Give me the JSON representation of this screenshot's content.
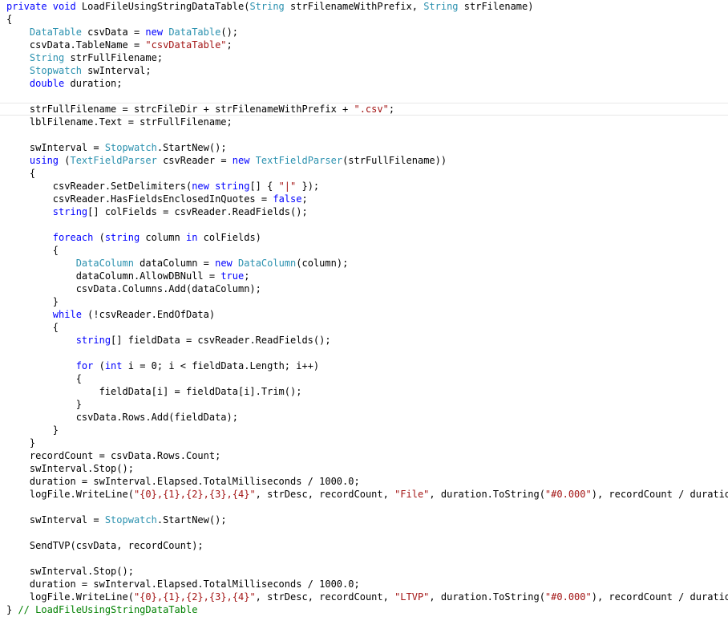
{
  "colors": {
    "background": "#ffffff",
    "plain": "#000000",
    "keyword": "#0000ff",
    "type": "#2b91af",
    "string": "#a31515",
    "comment": "#008000",
    "current_line_border": "#e8e8e8"
  },
  "editor": {
    "highlighted_line": 8,
    "lines": [
      [
        [
          "kw",
          "private void "
        ],
        [
          "plain",
          "LoadFileUsingStringDataTable("
        ],
        [
          "type",
          "String"
        ],
        [
          "plain",
          " strFilenameWithPrefix, "
        ],
        [
          "type",
          "String"
        ],
        [
          "plain",
          " strFilename)"
        ]
      ],
      [
        [
          "plain",
          "{"
        ]
      ],
      [
        [
          "type",
          "    DataTable"
        ],
        [
          "plain",
          " csvData = "
        ],
        [
          "kw",
          "new "
        ],
        [
          "type",
          "DataTable"
        ],
        [
          "plain",
          "();"
        ]
      ],
      [
        [
          "plain",
          "    csvData.TableName = "
        ],
        [
          "str",
          "\"csvDataTable\""
        ],
        [
          "plain",
          ";"
        ]
      ],
      [
        [
          "type",
          "    String"
        ],
        [
          "plain",
          " strFullFilename;"
        ]
      ],
      [
        [
          "type",
          "    Stopwatch"
        ],
        [
          "plain",
          " swInterval;"
        ]
      ],
      [
        [
          "kw",
          "    double"
        ],
        [
          "plain",
          " duration;"
        ]
      ],
      [],
      [
        [
          "plain",
          "    strFullFilename = strcFileDir + strFilenameWithPrefix + "
        ],
        [
          "str",
          "\".csv\""
        ],
        [
          "plain",
          ";"
        ]
      ],
      [
        [
          "plain",
          "    lblFilename.Text = strFullFilename;"
        ]
      ],
      [],
      [
        [
          "plain",
          "    swInterval = "
        ],
        [
          "type",
          "Stopwatch"
        ],
        [
          "plain",
          ".StartNew();"
        ]
      ],
      [
        [
          "kw",
          "    using"
        ],
        [
          "plain",
          " ("
        ],
        [
          "type",
          "TextFieldParser"
        ],
        [
          "plain",
          " csvReader = "
        ],
        [
          "kw",
          "new "
        ],
        [
          "type",
          "TextFieldParser"
        ],
        [
          "plain",
          "(strFullFilename))"
        ]
      ],
      [
        [
          "plain",
          "    {"
        ]
      ],
      [
        [
          "plain",
          "        csvReader.SetDelimiters("
        ],
        [
          "kw",
          "new string"
        ],
        [
          "plain",
          "[] { "
        ],
        [
          "str",
          "\"|\""
        ],
        [
          "plain",
          " });"
        ]
      ],
      [
        [
          "plain",
          "        csvReader.HasFieldsEnclosedInQuotes = "
        ],
        [
          "kw",
          "false"
        ],
        [
          "plain",
          ";"
        ]
      ],
      [
        [
          "kw",
          "        string"
        ],
        [
          "plain",
          "[] colFields = csvReader.ReadFields();"
        ]
      ],
      [],
      [
        [
          "kw",
          "        foreach"
        ],
        [
          "plain",
          " ("
        ],
        [
          "kw",
          "string"
        ],
        [
          "plain",
          " column "
        ],
        [
          "kw",
          "in"
        ],
        [
          "plain",
          " colFields)"
        ]
      ],
      [
        [
          "plain",
          "        {"
        ]
      ],
      [
        [
          "type",
          "            DataColumn"
        ],
        [
          "plain",
          " dataColumn = "
        ],
        [
          "kw",
          "new "
        ],
        [
          "type",
          "DataColumn"
        ],
        [
          "plain",
          "(column);"
        ]
      ],
      [
        [
          "plain",
          "            dataColumn.AllowDBNull = "
        ],
        [
          "kw",
          "true"
        ],
        [
          "plain",
          ";"
        ]
      ],
      [
        [
          "plain",
          "            csvData.Columns.Add(dataColumn);"
        ]
      ],
      [
        [
          "plain",
          "        }"
        ]
      ],
      [
        [
          "kw",
          "        while"
        ],
        [
          "plain",
          " (!csvReader.EndOfData)"
        ]
      ],
      [
        [
          "plain",
          "        {"
        ]
      ],
      [
        [
          "kw",
          "            string"
        ],
        [
          "plain",
          "[] fieldData = csvReader.ReadFields();"
        ]
      ],
      [],
      [
        [
          "kw",
          "            for"
        ],
        [
          "plain",
          " ("
        ],
        [
          "kw",
          "int"
        ],
        [
          "plain",
          " i = 0; i < fieldData.Length; i++)"
        ]
      ],
      [
        [
          "plain",
          "            {"
        ]
      ],
      [
        [
          "plain",
          "                fieldData[i] = fieldData[i].Trim();"
        ]
      ],
      [
        [
          "plain",
          "            }"
        ]
      ],
      [
        [
          "plain",
          "            csvData.Rows.Add(fieldData);"
        ]
      ],
      [
        [
          "plain",
          "        }"
        ]
      ],
      [
        [
          "plain",
          "    }"
        ]
      ],
      [
        [
          "plain",
          "    recordCount = csvData.Rows.Count;"
        ]
      ],
      [
        [
          "plain",
          "    swInterval.Stop();"
        ]
      ],
      [
        [
          "plain",
          "    duration = swInterval.Elapsed.TotalMilliseconds / 1000.0;"
        ]
      ],
      [
        [
          "plain",
          "    logFile.WriteLine("
        ],
        [
          "str",
          "\"{0},{1},{2},{3},{4}\""
        ],
        [
          "plain",
          ", strDesc, recordCount, "
        ],
        [
          "str",
          "\"File\""
        ],
        [
          "plain",
          ", duration.ToString("
        ],
        [
          "str",
          "\"#0.000\""
        ],
        [
          "plain",
          "), recordCount / duration);"
        ]
      ],
      [],
      [
        [
          "plain",
          "    swInterval = "
        ],
        [
          "type",
          "Stopwatch"
        ],
        [
          "plain",
          ".StartNew();"
        ]
      ],
      [],
      [
        [
          "plain",
          "    SendTVP(csvData, recordCount);"
        ]
      ],
      [],
      [
        [
          "plain",
          "    swInterval.Stop();"
        ]
      ],
      [
        [
          "plain",
          "    duration = swInterval.Elapsed.TotalMilliseconds / 1000.0;"
        ]
      ],
      [
        [
          "plain",
          "    logFile.WriteLine("
        ],
        [
          "str",
          "\"{0},{1},{2},{3},{4}\""
        ],
        [
          "plain",
          ", strDesc, recordCount, "
        ],
        [
          "str",
          "\"LTVP\""
        ],
        [
          "plain",
          ", duration.ToString("
        ],
        [
          "str",
          "\"#0.000\""
        ],
        [
          "plain",
          "), recordCount / duration);"
        ]
      ],
      [
        [
          "plain",
          "} "
        ],
        [
          "comment",
          "// LoadFileUsingStringDataTable"
        ]
      ]
    ]
  }
}
